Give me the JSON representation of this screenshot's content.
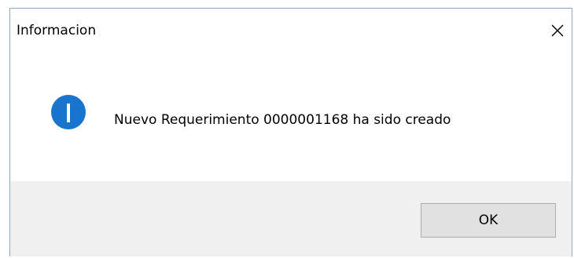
{
  "window": {
    "title": "Informacion",
    "close_glyph": "✕"
  },
  "dialog": {
    "icon": "info-icon",
    "message": "Nuevo Requerimiento 0000001168 ha sido creado"
  },
  "buttons": {
    "ok_label": "OK"
  },
  "colors": {
    "icon_blue": "#1874cd",
    "footer_bg": "#f0f0f0",
    "button_bg": "#e1e1e1",
    "button_border": "#adadad"
  }
}
